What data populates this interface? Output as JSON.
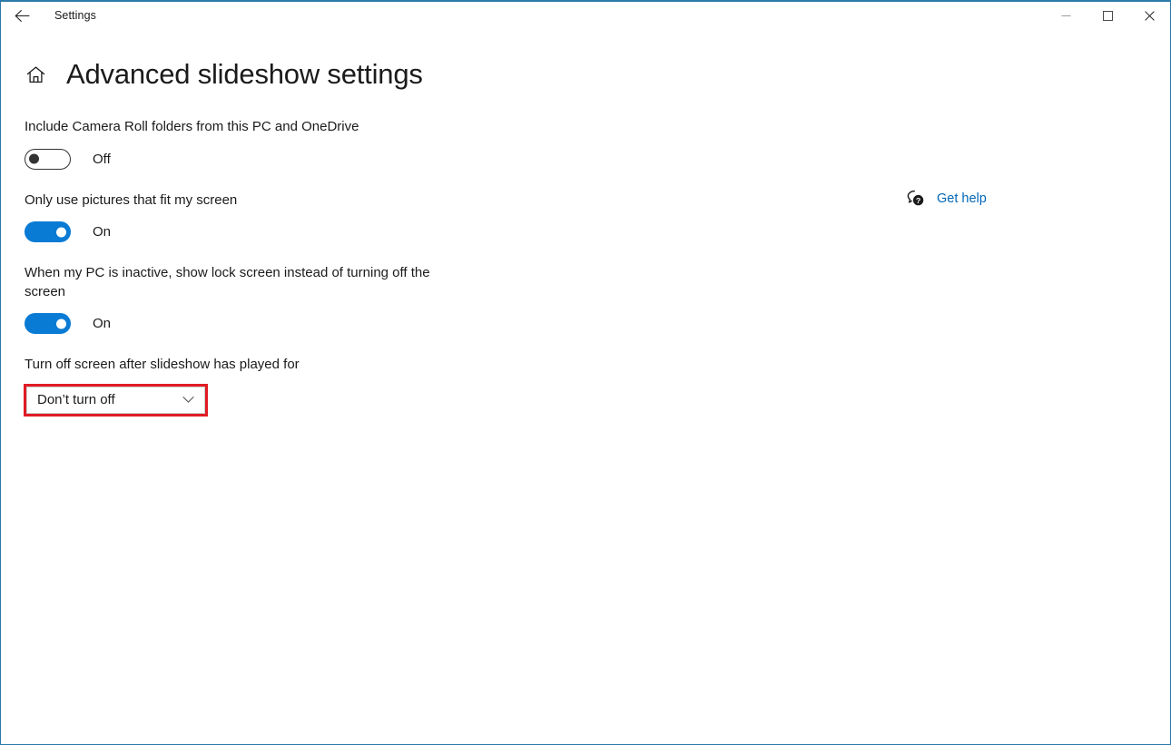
{
  "window": {
    "app_title": "Settings",
    "border_color": "#2b7aa8",
    "back_icon": "back-arrow-icon",
    "caption": {
      "minimize": "minimize-icon",
      "maximize": "maximize-icon",
      "close": "close-icon"
    }
  },
  "header": {
    "home_icon": "home-icon",
    "title": "Advanced slideshow settings"
  },
  "help": {
    "icon": "question-bubble-icon",
    "label": "Get help",
    "link_color": "#0067b8"
  },
  "settings": [
    {
      "label": "Include Camera Roll folders from this PC and OneDrive",
      "control": "toggle",
      "state": "Off",
      "on": false
    },
    {
      "label": "Only use pictures that fit my screen",
      "control": "toggle",
      "state": "On",
      "on": true
    },
    {
      "label": "When my PC is inactive, show lock screen instead of turning off the screen",
      "control": "toggle",
      "state": "On",
      "on": true
    },
    {
      "label": "Turn off screen after slideshow has played for",
      "control": "dropdown",
      "value": "Don’t turn off",
      "chevron_icon": "chevron-down-icon",
      "highlighted": true,
      "highlight_color": "#e01b24"
    }
  ],
  "colors": {
    "accent": "#0a7bd4",
    "text": "#1b1b1b",
    "highlight": "#e01b24"
  }
}
